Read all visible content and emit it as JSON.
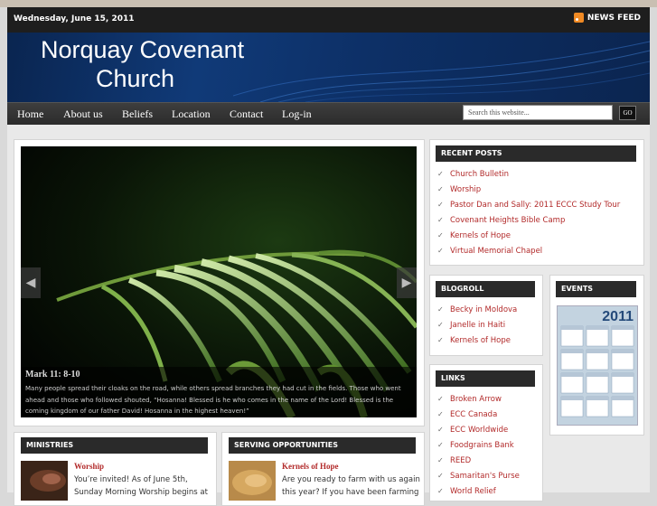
{
  "date": "Wednesday, June 15, 2011",
  "news_feed": "NEWS FEED",
  "site": {
    "title_line1": "Norquay Covenant",
    "title_line2": "Church"
  },
  "nav": {
    "items": [
      "Home",
      "About us",
      "Beliefs",
      "Location",
      "Contact",
      "Log-in"
    ]
  },
  "search": {
    "placeholder": "Search this website...",
    "button": "GO"
  },
  "slider": {
    "ref": "Mark 11: 8-10",
    "text": "Many people spread their cloaks on the road, while others spread branches they had cut in the fields. Those who went ahead and those who followed shouted, “Hosanna! Blessed is he who comes in the name of the Lord! Blessed is the coming kingdom of our father David! Hosanna in the highest heaven!”"
  },
  "recent_posts": {
    "title": "RECENT POSTS",
    "items": [
      "Church Bulletin",
      "Worship",
      "Pastor Dan and Sally: 2011 ECCC Study Tour",
      "Covenant Heights Bible Camp",
      "Kernels of Hope",
      "Virtual Memorial Chapel"
    ]
  },
  "blogroll": {
    "title": "BLOGROLL",
    "items": [
      "Becky in Moldova",
      "Janelle in Haiti",
      "Kernels of Hope"
    ]
  },
  "events": {
    "title": "EVENTS",
    "calendar_year": "2011"
  },
  "links": {
    "title": "LINKS",
    "items": [
      "Broken Arrow",
      "ECC Canada",
      "ECC Worldwide",
      "Foodgrains Bank",
      "REED",
      "Samaritan's Purse",
      "World Relief"
    ]
  },
  "ministries": {
    "title": "MINISTRIES",
    "item_title": "Worship",
    "item_text_1": "You’re invited! As of June 5th,",
    "item_text_2": "Sunday Morning Worship begins at"
  },
  "serving": {
    "title": "SERVING OPPORTUNITIES",
    "item_title": "Kernels of Hope",
    "item_text_1": "Are you ready to farm with us again",
    "item_text_2": "this year? If you have been farming"
  }
}
